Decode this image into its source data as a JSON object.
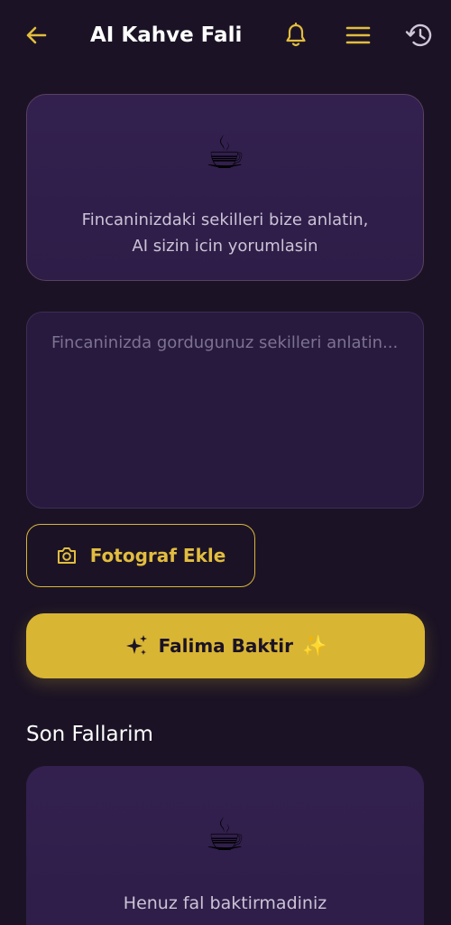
{
  "header": {
    "title": "AI Kahve Fali",
    "back_icon": "arrow-left-icon",
    "bell_icon": "bell-icon",
    "menu_icon": "menu-icon",
    "history_icon": "history-icon"
  },
  "info_card": {
    "icon": "coffee-cup-icon",
    "line1": "Fincaninizdaki sekilleri bize anlatin,",
    "line2": "AI sizin icin yorumlasin"
  },
  "description_input": {
    "value": "",
    "placeholder": "Fincaninizda gordugunuz sekilleri anlatin..."
  },
  "photo_button": {
    "label": "Fotograf Ekle",
    "icon": "camera-icon"
  },
  "submit_button": {
    "label": "Falima Baktir",
    "leading_icon": "sparkles-icon",
    "trailing_emoji": "✨"
  },
  "history": {
    "title": "Son Fallarim",
    "empty_icon": "coffee-cup-icon",
    "empty_text": "Henuz fal baktirmadiniz"
  },
  "colors": {
    "background": "#1b1325",
    "accent": "#d9b534",
    "card": "#2f1e4a"
  }
}
